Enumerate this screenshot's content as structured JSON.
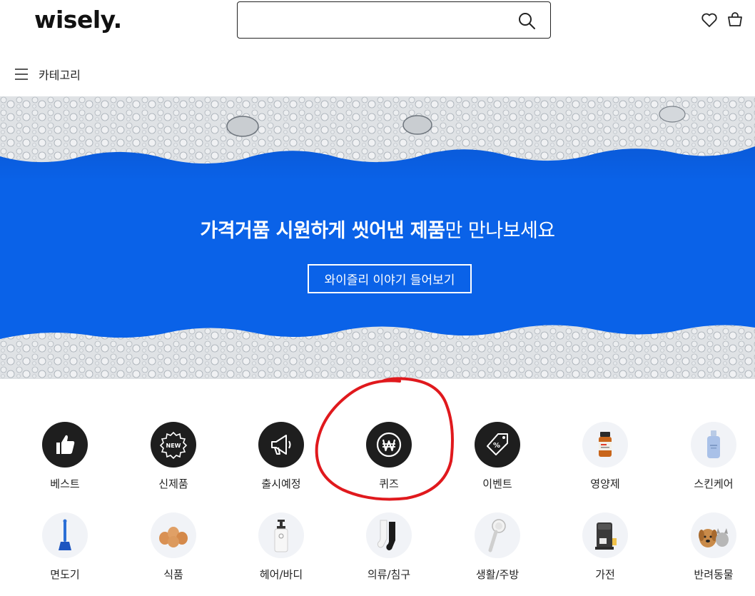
{
  "header": {
    "logo": "wisely.",
    "search": {
      "value": "",
      "placeholder": ""
    },
    "icons": [
      "search-icon",
      "heart-icon",
      "cart-icon",
      "menu-icon"
    ],
    "category_label": "카테고리"
  },
  "banner": {
    "title_bold": "가격거품 시원하게 씻어낸 제품",
    "title_regular": "만 만나보세요",
    "button_label": "와이즐리 이야기 들어보기",
    "colors": {
      "water": "#0a62e8",
      "foam": "#d9dcdf"
    }
  },
  "categories": {
    "row1": [
      {
        "label": "베스트",
        "icon": "thumbs-up-icon"
      },
      {
        "label": "신제품",
        "icon": "new-badge-icon"
      },
      {
        "label": "출시예정",
        "icon": "megaphone-icon"
      },
      {
        "label": "퀴즈",
        "icon": "won-coin-icon"
      },
      {
        "label": "이벤트",
        "icon": "discount-tag-icon"
      },
      {
        "label": "영양제",
        "icon": "supplement-bottle-icon"
      },
      {
        "label": "스킨케어",
        "icon": "skincare-bottle-icon"
      }
    ],
    "row2": [
      {
        "label": "면도기",
        "icon": "razor-icon"
      },
      {
        "label": "식품",
        "icon": "eggs-icon"
      },
      {
        "label": "헤어/바디",
        "icon": "pump-bottle-icon"
      },
      {
        "label": "의류/침구",
        "icon": "socks-icon"
      },
      {
        "label": "생활/주방",
        "icon": "shower-head-icon"
      },
      {
        "label": "가전",
        "icon": "coffee-machine-icon"
      },
      {
        "label": "반려동물",
        "icon": "pets-icon"
      }
    ]
  },
  "annotation": {
    "color": "#e0191d",
    "target": "퀴즈"
  }
}
